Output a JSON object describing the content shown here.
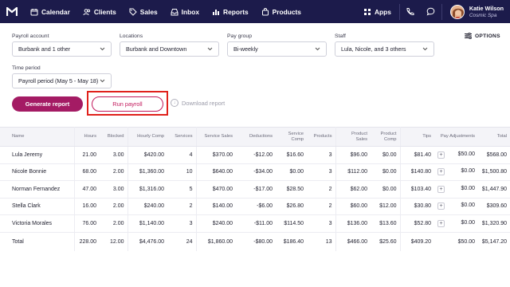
{
  "nav": {
    "items": [
      {
        "label": "Calendar",
        "icon": "calendar-icon"
      },
      {
        "label": "Clients",
        "icon": "users-icon"
      },
      {
        "label": "Sales",
        "icon": "tag-icon"
      },
      {
        "label": "Inbox",
        "icon": "inbox-icon"
      },
      {
        "label": "Reports",
        "icon": "bar-chart-icon"
      },
      {
        "label": "Products",
        "icon": "bag-icon"
      }
    ],
    "apps_label": "Apps",
    "user": {
      "name": "Katie Wilson",
      "org": "Cosmic Spa"
    }
  },
  "filters": {
    "payroll_account": {
      "label": "Payroll account",
      "value": "Burbank and 1 other"
    },
    "locations": {
      "label": "Locations",
      "value": "Burbank and Downtown"
    },
    "pay_group": {
      "label": "Pay group",
      "value": "Bi-weekly"
    },
    "staff": {
      "label": "Staff",
      "value": "Lula, Nicole, and 3 others"
    },
    "time_period": {
      "label": "Time period",
      "value": "Payroll period (May 5 - May 18)"
    },
    "options_label": "OPTIONS"
  },
  "actions": {
    "generate_label": "Generate report",
    "run_payroll_label": "Run payroll",
    "download_label": "Download report"
  },
  "table": {
    "columns": [
      "Name",
      "Hours",
      "Blocked",
      "Hourly Comp",
      "Services",
      "Service Sales",
      "Deductions",
      "Service Comp",
      "Products",
      "Product Sales",
      "Product Comp",
      "Tips",
      "Pay Adjustments",
      "Total"
    ],
    "rows": [
      [
        "Lula Jeremy",
        "21.00",
        "3.00",
        "$420.00",
        "4",
        "$370.00",
        "-$12.00",
        "$16.60",
        "3",
        "$96.00",
        "$0.00",
        "$81.40",
        "$50.00",
        "$568.00"
      ],
      [
        "Nicole Bonnie",
        "68.00",
        "2.00",
        "$1,360.00",
        "10",
        "$640.00",
        "-$34.00",
        "$0.00",
        "3",
        "$112.00",
        "$0.00",
        "$140.80",
        "$0.00",
        "$1,500.80"
      ],
      [
        "Norman Fernandez",
        "47.00",
        "3.00",
        "$1,316.00",
        "5",
        "$470.00",
        "-$17.00",
        "$28.50",
        "2",
        "$62.00",
        "$0.00",
        "$103.40",
        "$0.00",
        "$1,447.90"
      ],
      [
        "Stella Clark",
        "16.00",
        "2.00",
        "$240.00",
        "2",
        "$140.00",
        "-$6.00",
        "$26.80",
        "2",
        "$60.00",
        "$12.00",
        "$30.80",
        "$0.00",
        "$309.60"
      ],
      [
        "Victoria Morales",
        "76.00",
        "2.00",
        "$1,140.00",
        "3",
        "$240.00",
        "-$11.00",
        "$114.50",
        "3",
        "$136.00",
        "$13.60",
        "$52.80",
        "$0.00",
        "$1,320.90"
      ]
    ],
    "total": [
      "Total",
      "228.00",
      "12.00",
      "$4,476.00",
      "24",
      "$1,860.00",
      "-$80.00",
      "$186.40",
      "13",
      "$466.00",
      "$25.60",
      "$409.20",
      "$50.00",
      "$5,147.20"
    ]
  },
  "colors": {
    "nav_bg": "#1c1b4b",
    "primary": "#a41b64",
    "run_payroll": "#c2185b",
    "highlight_box": "#e0211b"
  }
}
